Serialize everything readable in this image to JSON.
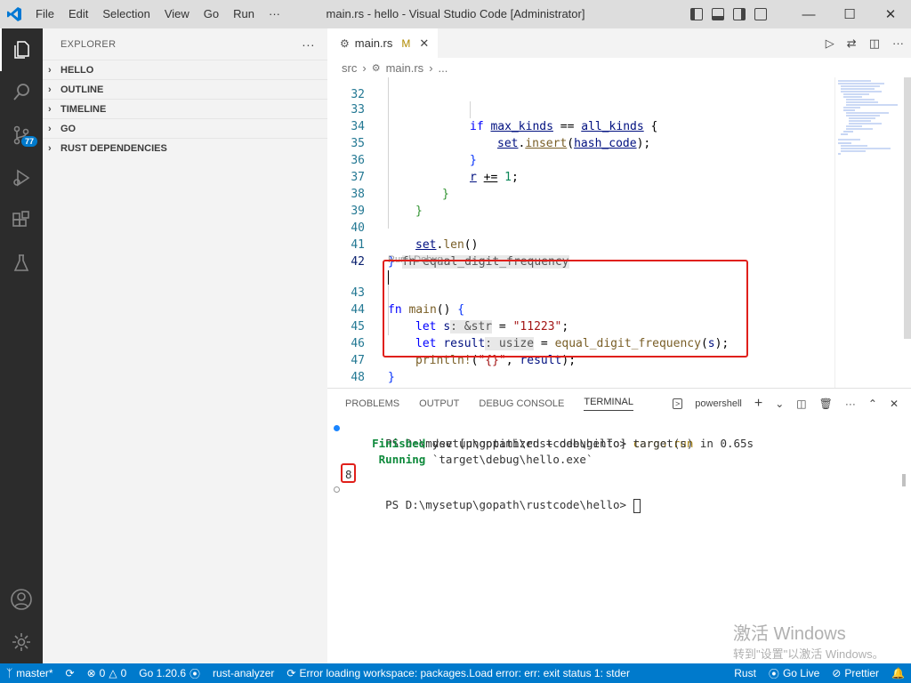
{
  "window": {
    "title": "main.rs - hello - Visual Studio Code [Administrator]",
    "menu": [
      "File",
      "Edit",
      "Selection",
      "View",
      "Go",
      "Run",
      "···"
    ],
    "controls": [
      "minimize",
      "maximize",
      "close"
    ]
  },
  "activity": {
    "items": [
      "explorer-icon",
      "search-icon",
      "source-control-icon",
      "run-debug-icon",
      "extensions-icon",
      "testing-icon"
    ],
    "scm_badge": "77",
    "bottom": [
      "accounts-icon",
      "settings-icon"
    ]
  },
  "sidebar": {
    "title": "EXPLORER",
    "more": "···",
    "sections": [
      "HELLO",
      "OUTLINE",
      "TIMELINE",
      "GO",
      "RUST DEPENDENCIES"
    ]
  },
  "editor": {
    "tab_label": "main.rs",
    "tab_modified": "M",
    "breadcrumb": [
      "src",
      "main.rs",
      "..."
    ],
    "codelens": "Run | Debug",
    "lines": [
      {
        "n": "32",
        "indent": "",
        "text": ""
      },
      {
        "n": "33",
        "indent": "            ",
        "text": "if max_kinds == all_kinds {"
      },
      {
        "n": "34",
        "indent": "                ",
        "text": "set.insert(hash_code);"
      },
      {
        "n": "35",
        "indent": "            ",
        "text": "}"
      },
      {
        "n": "36",
        "indent": "            ",
        "text": "r += 1;"
      },
      {
        "n": "37",
        "indent": "        ",
        "text": "}"
      },
      {
        "n": "38",
        "indent": "    ",
        "text": "}"
      },
      {
        "n": "39",
        "indent": "",
        "text": ""
      },
      {
        "n": "40",
        "indent": "    ",
        "text": "set.len()"
      },
      {
        "n": "41",
        "indent": "",
        "text": "} fn equal_digit_frequency"
      },
      {
        "n": "42",
        "indent": "",
        "text": ""
      },
      {
        "n": "43",
        "indent": "",
        "text": "fn main() {"
      },
      {
        "n": "44",
        "indent": "    ",
        "text": "let s: &str = \"11223\";"
      },
      {
        "n": "45",
        "indent": "    ",
        "text": "let result: usize = equal_digit_frequency(s);"
      },
      {
        "n": "46",
        "indent": "    ",
        "text": "println!(\"{}\", result);"
      },
      {
        "n": "47",
        "indent": "",
        "text": "}"
      },
      {
        "n": "48",
        "indent": "",
        "text": ""
      }
    ]
  },
  "panel": {
    "tabs": [
      "PROBLEMS",
      "OUTPUT",
      "DEBUG CONSOLE",
      "TERMINAL"
    ],
    "active_tab": "TERMINAL",
    "shell": "powershell",
    "terminal": {
      "prompt1": "PS D:\\mysetup\\gopath\\rustcode\\hello> ",
      "cmd1": "cargo run",
      "finished_word": "Finished",
      "finished_rest": " dev [unoptimized + debuginfo] target(s) in 0.65s",
      "running_word": "Running",
      "running_rest": " `target\\debug\\hello.exe`",
      "output": "8",
      "prompt2": "PS D:\\mysetup\\gopath\\rustcode\\hello> "
    }
  },
  "watermark": {
    "line1": "激活 Windows",
    "line2": "转到\"设置\"以激活 Windows。"
  },
  "statusbar": {
    "branch": "master*",
    "errors": "0",
    "warnings": "0",
    "go_version": "Go 1.20.6",
    "analyzer": "rust-analyzer",
    "message": "Error loading workspace: packages.Load error: err: exit status 1: stderr: go",
    "language": "Rust",
    "go_live": "Go Live",
    "prettier": "Prettier"
  },
  "colors": {
    "accent": "#007acc",
    "highlight_box": "#e0201b",
    "activity_bar": "#2c2c2c"
  }
}
